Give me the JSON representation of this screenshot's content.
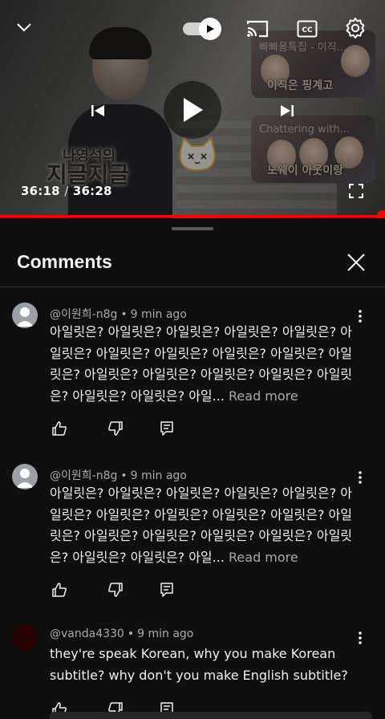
{
  "player": {
    "current_time": "36:18",
    "separator": "/",
    "duration": "36:28",
    "progress_fraction": 0.993,
    "autoplay_on": true,
    "show_title_line1": "나영석의",
    "show_title_line2": "지글지글",
    "cards": [
      {
        "caption": "빠빠용특집 - 이직...",
        "subtitle": "이직은 핑계고"
      },
      {
        "caption": "Chattering with...",
        "subtitle": "노웨이 아웃이랑"
      }
    ],
    "colors": {
      "progress": "#ff0000",
      "track": "#555555"
    }
  },
  "comments_panel": {
    "title": "Comments",
    "comments": [
      {
        "author": "@이원희-n8g",
        "dot": "•",
        "time": "9 min ago",
        "text": "아일릿은? 아일릿은? 아일릿은? 아일릿은? 아일릿은? 아일릿은? 아일릿은? 아일릿은? 아일릿은? 아일릿은? 아일릿은? 아일릿은? 아일릿은? 아일릿은? 아일릿은? 아일릿은? 아일릿은? 아일릿은? 아일...",
        "read_more": "Read more"
      },
      {
        "author": "@이원희-n8g",
        "dot": "•",
        "time": "9 min ago",
        "text": "아일릿은? 아일릿은? 아일릿은? 아일릿은? 아일릿은? 아일릿은? 아일릿은? 아일릿은? 아일릿은? 아일릿은? 아일릿은? 아일릿은? 아일릿은? 아일릿은? 아일릿은? 아일릿은? 아일릿은? 아일릿은? 아일...",
        "read_more": "Read more"
      },
      {
        "author": "@vanda4330",
        "dot": "•",
        "time": "9 min ago",
        "text": "they're speak Korean, why you make Korean subtitle? why don't you make English subtitle?",
        "read_more": ""
      }
    ]
  }
}
